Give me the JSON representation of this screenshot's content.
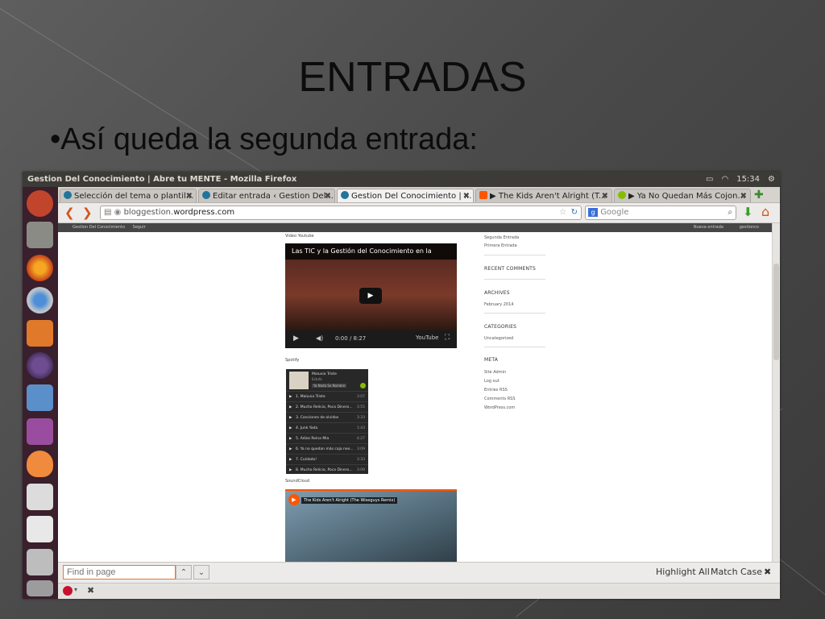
{
  "slide": {
    "title": "ENTRADAS",
    "bullet": "•Así queda la segunda entrada:"
  },
  "window": {
    "title": "Gestion Del Conocimiento | Abre tu MENTE - Mozilla Firefox",
    "clock": "15:34"
  },
  "tabs": [
    {
      "label": "Selección del tema o plantil...",
      "icon": "wordpress-icon",
      "active": false
    },
    {
      "label": "Editar entrada ‹ Gestion Del...",
      "icon": "wordpress-icon",
      "active": false
    },
    {
      "label": "Gestion Del Conocimiento | ...",
      "icon": "wordpress-icon",
      "active": true
    },
    {
      "label": "▶ The Kids Aren't Alright (T...",
      "icon": "soundcloud-icon",
      "active": false
    },
    {
      "label": "▶ Ya No Quedan Más Cojon...",
      "icon": "spotify-icon",
      "active": false
    }
  ],
  "nav": {
    "url_domain_prefix": "bloggestion.",
    "url_domain_bold": "wordpress.com",
    "search_engine": "Google"
  },
  "wpbar": {
    "site": "Gestion Del Conocimiento",
    "follow": "Seguir",
    "new_post": "Nueva entrada",
    "user": "gestionco"
  },
  "post": {
    "video_label": "Video Youtube",
    "video_title": "Las TIC y la Gestión del Conocimiento en la",
    "video_time": "0:00 / 8:27",
    "video_brand": "YouTube",
    "spotify_label": "Spotify",
    "spotify_album": "Maluvia Triste",
    "spotify_artist": "Estufa",
    "spotify_follow": "Ya Nada Se Nombre",
    "tracks": [
      {
        "name": "1. Maluvia Triste",
        "dur": "3:07"
      },
      {
        "name": "2. Mucho Relicio, Poca Dinero...",
        "dur": "3:55"
      },
      {
        "name": "3. Canciones de olvidos",
        "dur": "3:33"
      },
      {
        "name": "4. Junk Yada",
        "dur": "1:43"
      },
      {
        "name": "5. Adios Reina Mia",
        "dur": "4:27"
      },
      {
        "name": "6. Ya no quedan más caja neo...",
        "dur": "3:09"
      },
      {
        "name": "7. Cuidado!",
        "dur": "3:33"
      },
      {
        "name": "8. Mucho Relicio, Poca Dinero...",
        "dur": "3:09"
      }
    ],
    "soundcloud_label": "SoundCloud",
    "soundcloud_title": "The Kids Aren't Alright (The Wiseguys Remix)"
  },
  "sidebar": {
    "recent_posts": [
      "Segunda Entrada",
      "Primera Entrada"
    ],
    "recent_comments": "RECENT COMMENTS",
    "archives": "ARCHIVES",
    "archive_items": [
      "February 2014"
    ],
    "categories": "CATEGORIES",
    "category_items": [
      "Uncategorized"
    ],
    "meta": "META",
    "meta_items": [
      "Site Admin",
      "Log out",
      "Entries RSS",
      "Comments RSS",
      "WordPress.com"
    ]
  },
  "findbar": {
    "placeholder": "Find in page",
    "highlight_all": "Highlight All",
    "match_case": "Match Case"
  },
  "colors": {
    "launcher": "#3a1f2c",
    "firefox_accent": "#d2541e",
    "soundcloud": "#ff5500"
  }
}
